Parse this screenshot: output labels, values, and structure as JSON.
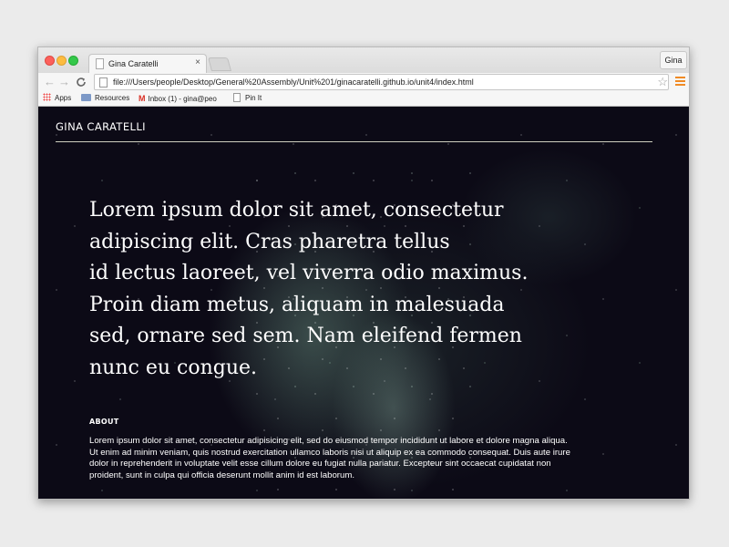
{
  "browser": {
    "tab_title": "Gina Caratelli",
    "tab_close": "×",
    "profile": "Gina",
    "url": "file:///Users/people/Desktop/General%20Assembly/Unit%201/ginacaratelli.github.io/unit4/index.html",
    "nav": {
      "back": "←",
      "forward": "→",
      "reload": "C"
    },
    "star": "☆",
    "bookmarks": [
      {
        "label": "Apps"
      },
      {
        "label": "Resources"
      },
      {
        "label": "Inbox (1) - gina@peo"
      },
      {
        "label": "Pin It"
      }
    ]
  },
  "page": {
    "site_title": "GINA CARATELLI",
    "hero_lines": [
      "Lorem ipsum dolor sit amet, consectetur",
      "adipiscing elit. Cras pharetra tellus",
      "id lectus laoreet, vel viverra odio maximus.",
      "Proin diam metus, aliquam in malesuada",
      "sed, ornare sed sem. Nam eleifend fermen",
      "nunc eu congue."
    ],
    "about_heading": "ABOUT",
    "about_lines": [
      "Lorem ipsum dolor sit amet, consectetur adipisicing elit, sed do eiusmod tempor incididunt ut labore et dolore magna aliqua.",
      "Ut enim ad minim veniam, quis nostrud exercitation ullamco laboris nisi ut aliquip ex ea commodo consequat. Duis aute irure",
      "dolor in reprehenderit in voluptate velit esse cillum dolore eu fugiat nulla pariatur. Excepteur sint occaecat cupidatat non",
      "proident, sunt in culpa qui officia deserunt mollit anim id est laborum."
    ]
  },
  "colors": {
    "page_background": "#0c0a16",
    "title_rule": "#cfcfbf",
    "menu_icon": "#f08a24"
  }
}
